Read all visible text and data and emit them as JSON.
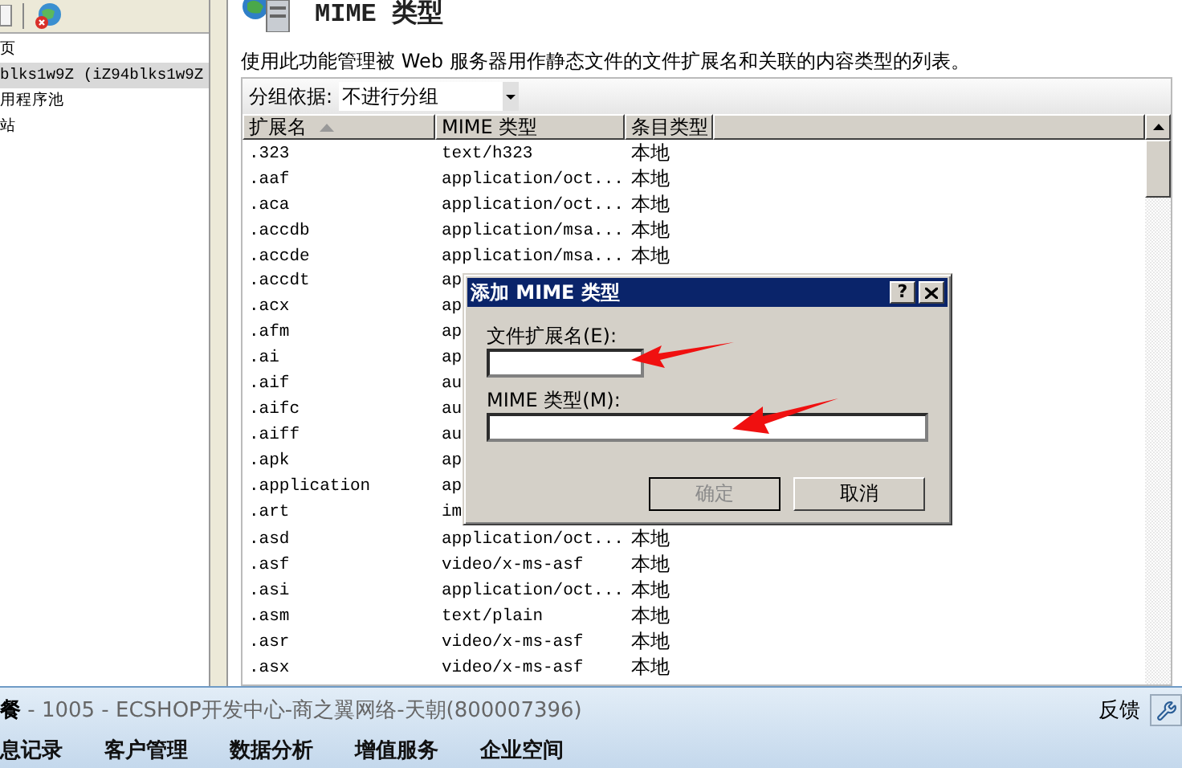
{
  "tree": {
    "items": [
      {
        "label": "页",
        "selected": false
      },
      {
        "label": "blks1w9Z (iZ94blks1w9Z",
        "selected": true
      },
      {
        "label": "用程序池",
        "selected": false
      },
      {
        "label": "站",
        "selected": false
      }
    ]
  },
  "page": {
    "title": "MIME 类型",
    "description": "使用此功能管理被 Web 服务器用作静态文件的文件扩展名和关联的内容类型的列表。"
  },
  "group_by": {
    "label": "分组依据:",
    "value": "不进行分组"
  },
  "table": {
    "columns": [
      {
        "label": "扩展名",
        "sorted": true
      },
      {
        "label": "MIME 类型",
        "sorted": false
      },
      {
        "label": "条目类型",
        "sorted": false
      }
    ],
    "rows": [
      {
        "extension": ".323",
        "mime_type": "text/h323",
        "entry_type": "本地"
      },
      {
        "extension": ".aaf",
        "mime_type": "application/oct...",
        "entry_type": "本地"
      },
      {
        "extension": ".aca",
        "mime_type": "application/oct...",
        "entry_type": "本地"
      },
      {
        "extension": ".accdb",
        "mime_type": "application/msa...",
        "entry_type": "本地"
      },
      {
        "extension": ".accde",
        "mime_type": "application/msa...",
        "entry_type": "本地"
      },
      {
        "extension": ".accdt",
        "mime_type": "ap"
      },
      {
        "extension": ".acx",
        "mime_type": "ap"
      },
      {
        "extension": ".afm",
        "mime_type": "ap"
      },
      {
        "extension": ".ai",
        "mime_type": "ap"
      },
      {
        "extension": ".aif",
        "mime_type": "au"
      },
      {
        "extension": ".aifc",
        "mime_type": "au"
      },
      {
        "extension": ".aiff",
        "mime_type": "au"
      },
      {
        "extension": ".apk",
        "mime_type": "ap"
      },
      {
        "extension": ".application",
        "mime_type": "ap"
      },
      {
        "extension": ".art",
        "mime_type": "im"
      },
      {
        "extension": ".asd",
        "mime_type": "application/oct...",
        "entry_type": "本地"
      },
      {
        "extension": ".asf",
        "mime_type": "video/x-ms-asf",
        "entry_type": "本地"
      },
      {
        "extension": ".asi",
        "mime_type": "application/oct...",
        "entry_type": "本地"
      },
      {
        "extension": ".asm",
        "mime_type": "text/plain",
        "entry_type": "本地"
      },
      {
        "extension": ".asr",
        "mime_type": "video/x-ms-asf",
        "entry_type": "本地"
      },
      {
        "extension": ".asx",
        "mime_type": "video/x-ms-asf",
        "entry_type": "本地"
      }
    ]
  },
  "dialog": {
    "title": "添加 MIME 类型",
    "help_label": "?",
    "extension_label": "文件扩展名(E):",
    "mime_label": "MIME 类型(M):",
    "buttons": [
      {
        "label": "确定",
        "disabled": true
      },
      {
        "label": "取消",
        "disabled": false
      }
    ]
  },
  "chat_bar": {
    "title": "餐",
    "subtitle": " - 1005 - ECSHOP开发中心-商之翼网络-天朝(800007396)",
    "feedback": "反馈",
    "tabs": [
      "息记录",
      "客户管理",
      "数据分析",
      "增值服务",
      "企业空间"
    ]
  }
}
